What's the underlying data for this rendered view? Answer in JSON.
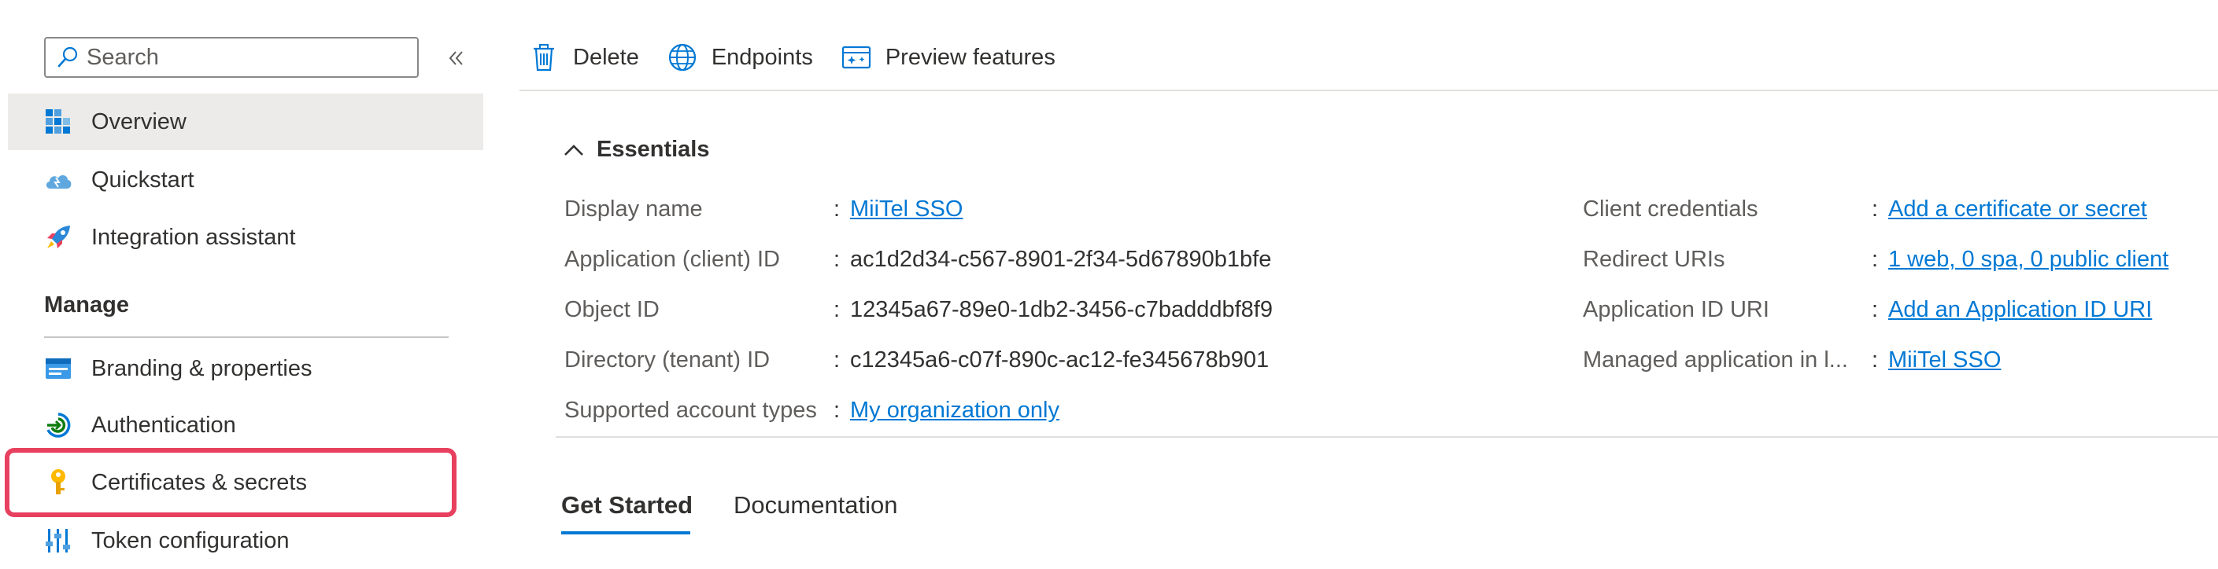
{
  "sidebar": {
    "search": {
      "placeholder": "Search"
    },
    "items": [
      {
        "label": "Overview",
        "icon": "overview-icon",
        "active": true
      },
      {
        "label": "Quickstart",
        "icon": "quickstart-cloud-icon"
      },
      {
        "label": "Integration assistant",
        "icon": "rocket-icon"
      }
    ],
    "manage": {
      "heading": "Manage",
      "items": [
        {
          "label": "Branding & properties",
          "icon": "branding-icon"
        },
        {
          "label": "Authentication",
          "icon": "authentication-icon"
        },
        {
          "label": "Certificates & secrets",
          "icon": "key-icon",
          "highlighted": true
        },
        {
          "label": "Token configuration",
          "icon": "token-config-icon"
        }
      ]
    }
  },
  "toolbar": {
    "delete_label": "Delete",
    "endpoints_label": "Endpoints",
    "preview_label": "Preview features"
  },
  "essentials": {
    "title": "Essentials",
    "left": [
      {
        "label": "Display name",
        "value": "MiiTel SSO",
        "link": true
      },
      {
        "label": "Application (client) ID",
        "value": "ac1d2d34-c567-8901-2f34-5d67890b1bfe",
        "link": false
      },
      {
        "label": "Object ID",
        "value": "12345a67-89e0-1db2-3456-c7badddbf8f9",
        "link": false
      },
      {
        "label": "Directory (tenant) ID",
        "value": "c12345a6-c07f-890c-ac12-fe345678b901",
        "link": false
      },
      {
        "label": "Supported account types",
        "value": "My organization only",
        "link": true
      }
    ],
    "right": [
      {
        "label": "Client credentials",
        "value": "Add a certificate or secret",
        "link": true
      },
      {
        "label": "Redirect URIs",
        "value": "1 web, 0 spa, 0 public client",
        "link": true
      },
      {
        "label": "Application ID URI",
        "value": "Add an Application ID URI",
        "link": true
      },
      {
        "label": "Managed application in l...",
        "value": "MiiTel SSO",
        "link": true
      }
    ],
    "colon": ":"
  },
  "tabs": [
    {
      "label": "Get Started",
      "selected": true
    },
    {
      "label": "Documentation",
      "selected": false
    }
  ],
  "colors": {
    "accent": "#0078d4",
    "highlight": "#e8405f",
    "active_bg": "#edebe9"
  }
}
